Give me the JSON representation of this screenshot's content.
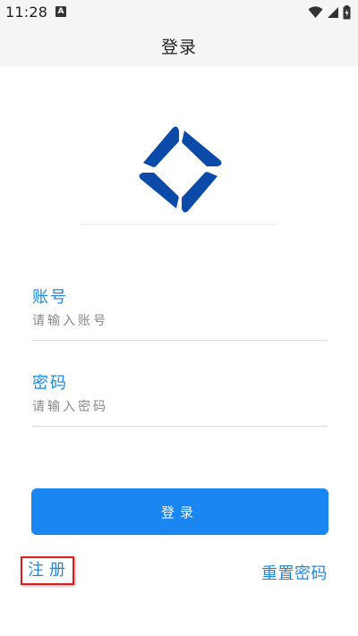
{
  "status_bar": {
    "time": "11:28",
    "notification_icon_letter": "A",
    "icons": [
      "wifi-icon",
      "cell-signal-icon",
      "battery-icon"
    ]
  },
  "header": {
    "title": "登录"
  },
  "form": {
    "account": {
      "label": "账号",
      "placeholder": "请输入账号",
      "value": ""
    },
    "password": {
      "label": "密码",
      "placeholder": "请输入密码",
      "value": ""
    },
    "login_button_label": "登录"
  },
  "links": {
    "register": "注册",
    "reset_password": "重置密码"
  },
  "colors": {
    "accent": "#1a86f2",
    "link": "#1e88e5",
    "logo": "#0b4aa8",
    "highlight_border": "#d62020"
  }
}
